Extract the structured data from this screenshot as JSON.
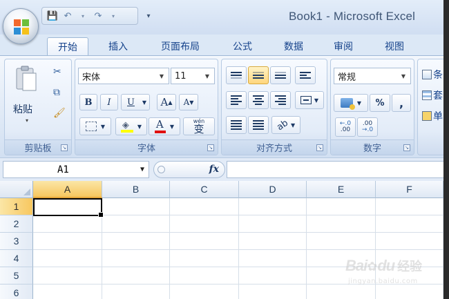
{
  "window": {
    "title": "Book1 - Microsoft Excel"
  },
  "qat": {
    "save": "💾",
    "undo": "↶",
    "redo": "↷",
    "dropdown": "▾",
    "customize": "▾"
  },
  "tabs": [
    {
      "label": "开始",
      "active": true
    },
    {
      "label": "插入"
    },
    {
      "label": "页面布局"
    },
    {
      "label": "公式"
    },
    {
      "label": "数据"
    },
    {
      "label": "审阅"
    },
    {
      "label": "视图"
    }
  ],
  "ribbon": {
    "clipboard": {
      "label": "剪贴板",
      "paste": "粘贴"
    },
    "font": {
      "label": "字体",
      "font_name": "宋体",
      "font_size": "11",
      "bold": "B",
      "italic": "I",
      "underline": "U",
      "grow": "A",
      "shrink": "A",
      "wen": "wén",
      "wen_char": "变"
    },
    "align": {
      "label": "对齐方式"
    },
    "number": {
      "label": "数字",
      "format": "常规",
      "percent": "%",
      "comma": ",",
      "inc_dec": ".00",
      "dec_dec": ".00"
    },
    "styles": {
      "cond": "条",
      "table": "套",
      "cell": "单"
    }
  },
  "formula_bar": {
    "name_box": "A1",
    "fx": "fx",
    "formula": ""
  },
  "grid": {
    "columns": [
      "A",
      "B",
      "C",
      "D",
      "E",
      "F"
    ],
    "rows": [
      "1",
      "2",
      "3",
      "4",
      "5",
      "6"
    ],
    "active_cell": "A1"
  },
  "watermark": {
    "brand": "Bai",
    "brand2": "du",
    "cn": "经验",
    "url": "jingyan.baidu.com"
  },
  "colors": {
    "accent": "#15428b",
    "selected_header": "#f7c75f",
    "ribbon_bg": "#dfe9f6"
  }
}
